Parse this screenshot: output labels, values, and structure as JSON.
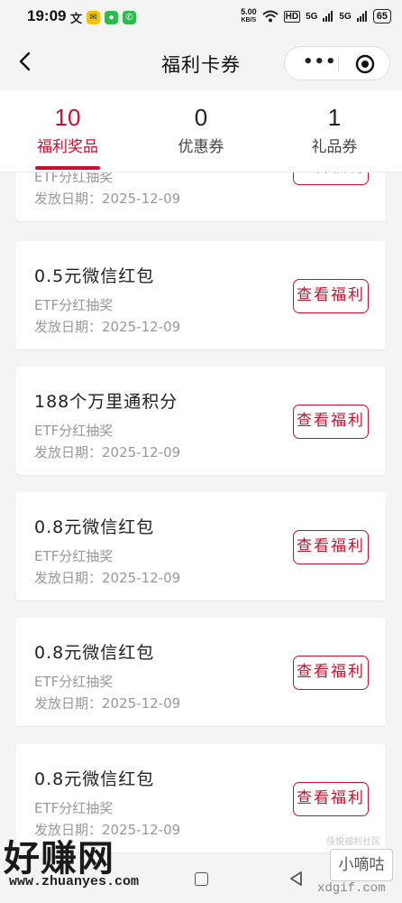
{
  "status_bar": {
    "time": "19:09",
    "net_speed_value": "5.00",
    "net_speed_unit": "KB/S",
    "hd_label": "HD",
    "sig1": "5G",
    "sig2": "5G",
    "battery": "65"
  },
  "nav": {
    "title": "福利卡券",
    "more_label": "•••"
  },
  "tabs": [
    {
      "count": "10",
      "label": "福利奖品",
      "active": true
    },
    {
      "count": "0",
      "label": "优惠券",
      "active": false
    },
    {
      "count": "1",
      "label": "礼品券",
      "active": false
    }
  ],
  "cards": [
    {
      "title": "",
      "subtitle": "ETF分红抽奖",
      "date": "发放日期：2025-12-09",
      "button": "查看福利"
    },
    {
      "title": "0.5元微信红包",
      "subtitle": "ETF分红抽奖",
      "date": "发放日期：2025-12-09",
      "button": "查看福利"
    },
    {
      "title": "188个万里通积分",
      "subtitle": "ETF分红抽奖",
      "date": "发放日期：2025-12-09",
      "button": "查看福利"
    },
    {
      "title": "0.8元微信红包",
      "subtitle": "ETF分红抽奖",
      "date": "发放日期：2025-12-09",
      "button": "查看福利"
    },
    {
      "title": "0.8元微信红包",
      "subtitle": "ETF分红抽奖",
      "date": "发放日期：2025-12-09",
      "button": "查看福利"
    },
    {
      "title": "0.8元微信红包",
      "subtitle": "ETF分红抽奖",
      "date": "发放日期：2025-12-09",
      "button": "查看福利"
    }
  ],
  "watermark": {
    "left_logo": "好赚网",
    "left_url": "www.zhuanyes.com",
    "right_logo": "小嘀咕",
    "right_url": "xdgif.com",
    "tiny": "佳悦福利社区"
  },
  "colors": {
    "accent": "#c8102e",
    "background": "#f4f4f4",
    "card": "#ffffff"
  }
}
